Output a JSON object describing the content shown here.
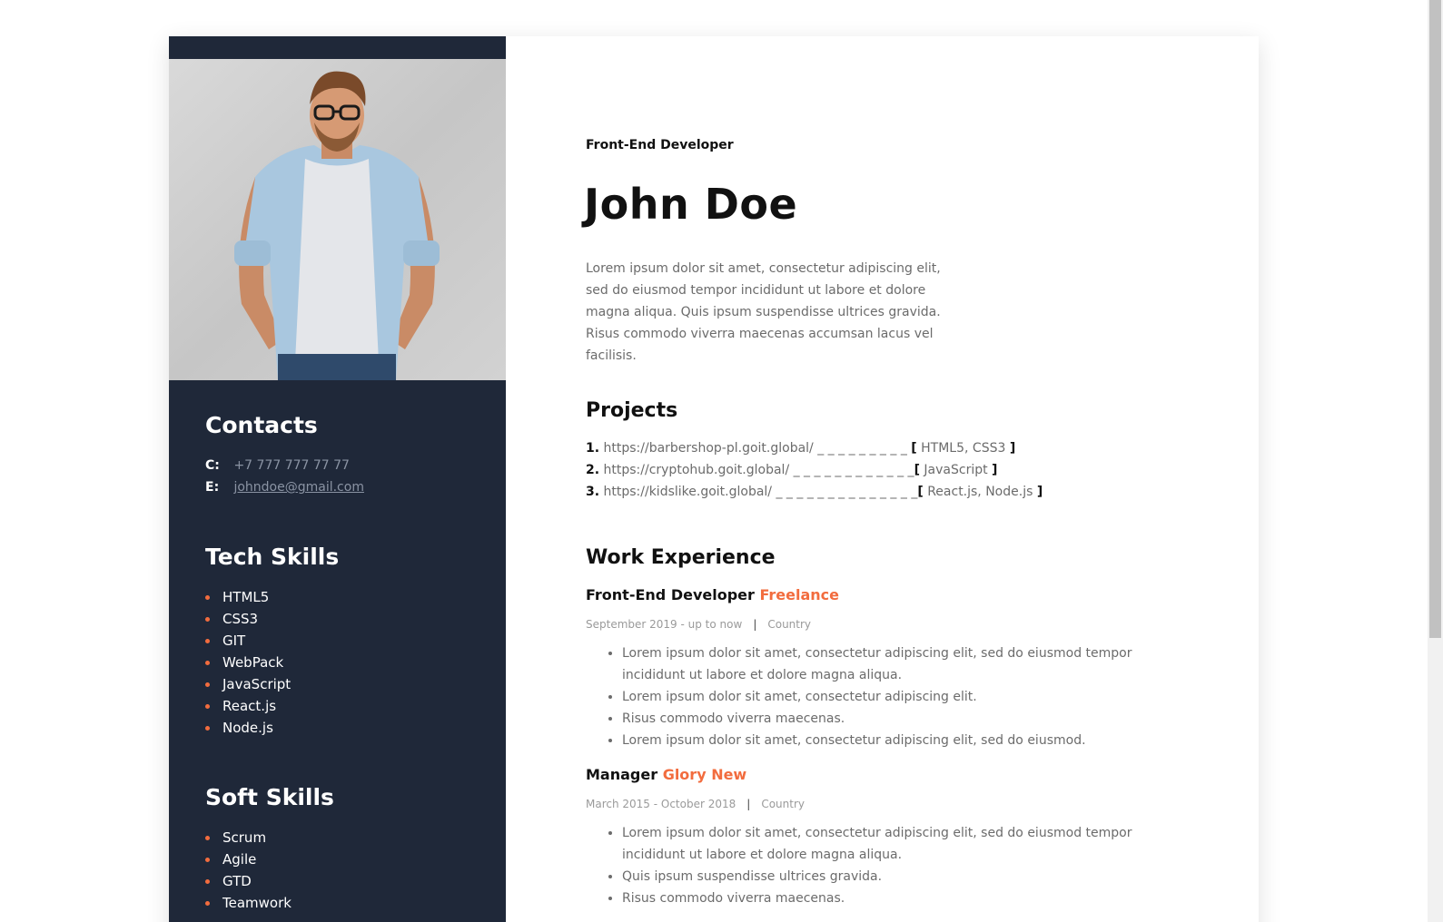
{
  "sidebar": {
    "photo_alt": "John Doe photo",
    "contacts_title": "Contacts",
    "contacts": [
      {
        "key": "C:",
        "value": "+7 777 777 77 77"
      },
      {
        "key": "E:",
        "value": "johndoe@gmail.com"
      }
    ],
    "tech_title": "Tech Skills",
    "tech_skills": [
      "HTML5",
      "CSS3",
      "GIT",
      "WebPack",
      "JavaScript",
      "React.js",
      "Node.js"
    ],
    "soft_title": "Soft Skills",
    "soft_skills": [
      "Scrum",
      "Agile",
      "GTD",
      "Teamwork"
    ]
  },
  "main": {
    "role": "Front-End Developer",
    "name": "John Doe",
    "about": "Lorem ipsum dolor sit amet, consectetur adipiscing elit, sed do eiusmod tempor incididunt ut labore et dolore magna aliqua. Quis ipsum suspendisse ultrices gravida. Risus commodo viverra maecenas accumsan lacus vel facilisis.",
    "projects_title": "Projects",
    "projects": [
      {
        "num": "1.",
        "url": "https://barbershop-pl.goit.global/",
        "dash": " _ _ _ _ _ _ _ _ _ ",
        "tech": " HTML5, CSS3 "
      },
      {
        "num": "2.",
        "url": "https://cryptohub.goit.global/",
        "dash": " _ _ _ _ _ _ _ _ _ _ _ _",
        "tech": " JavaScript "
      },
      {
        "num": "3.",
        "url": "https://kidslike.goit.global/",
        "dash": " _ _ _ _ _ _ _ _ _ _ _ _ _ _",
        "tech": " React.js, Node.js "
      }
    ],
    "experience_title": "Work Experience",
    "jobs": [
      {
        "title": "Front-End Developer",
        "company": "Freelance",
        "period": "September 2019 - up to now",
        "separator": "|",
        "location": "Country",
        "items": [
          "Lorem ipsum dolor sit amet, consectetur adipiscing elit, sed do eiusmod tempor incididunt ut labore et dolore magna aliqua.",
          "Lorem ipsum dolor sit amet, consectetur adipiscing elit.",
          "Risus commodo viverra maecenas.",
          "Lorem ipsum dolor sit amet, consectetur adipiscing elit, sed do eiusmod."
        ]
      },
      {
        "title": "Manager",
        "company": "Glory New",
        "period": "March 2015 - October 2018",
        "separator": "|",
        "location": "Country",
        "items": [
          "Lorem ipsum dolor sit amet, consectetur adipiscing elit, sed do eiusmod tempor incididunt ut labore et dolore magna aliqua.",
          "Quis ipsum suspendisse ultrices gravida.",
          "Risus commodo viverra maecenas."
        ]
      }
    ]
  },
  "colors": {
    "sidebar_bg": "#1f2839",
    "accent": "#f26c3e",
    "text_muted": "#6b6b6b"
  }
}
